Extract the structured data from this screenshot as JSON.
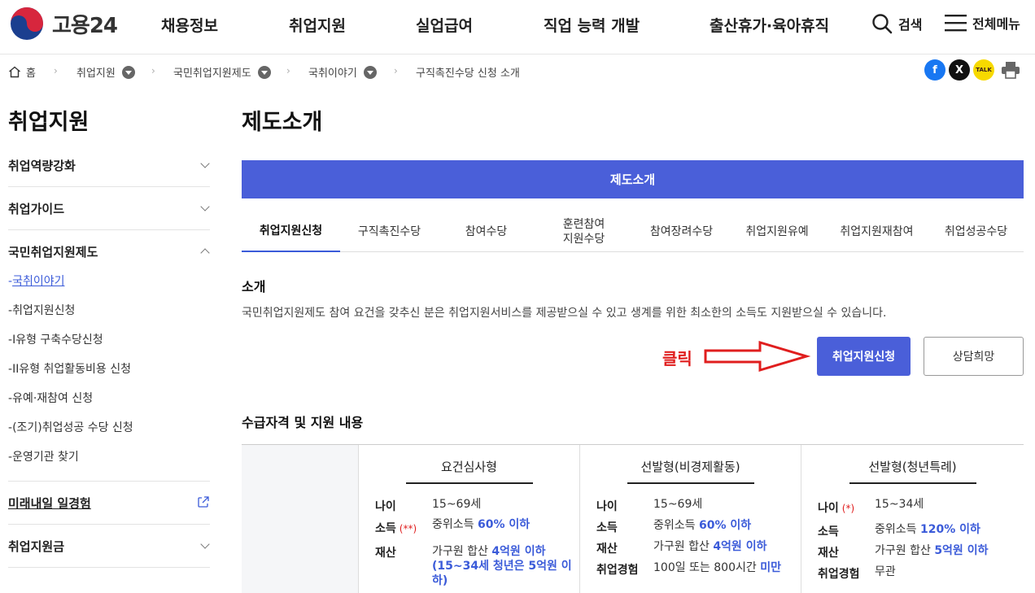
{
  "header": {
    "logo_text": "고용24",
    "nav": [
      "채용정보",
      "취업지원",
      "실업급여",
      "직업 능력 개발",
      "출산휴가·육아휴직"
    ],
    "search_label": "검색",
    "menu_label": "전체메뉴"
  },
  "breadcrumb": {
    "home": "홈",
    "items": [
      "취업지원",
      "국민취업지원제도",
      "국취이야기",
      "구직촉진수당 신청 소개"
    ]
  },
  "share": {
    "facebook": "f",
    "x": "X",
    "kakao": "TALK"
  },
  "sidebar": {
    "title": "취업지원",
    "items": [
      {
        "label": "취업역량강화"
      },
      {
        "label": "취업가이드"
      },
      {
        "label": "국민취업지원제도"
      }
    ],
    "sub_items": [
      {
        "prefix": "-",
        "label": "국취이야기"
      },
      {
        "prefix": "-",
        "label": "취업지원신청"
      },
      {
        "prefix": "-",
        "label": "I유형 구축수당신청"
      },
      {
        "prefix": "-",
        "label": "II유형 취업활동비용 신청"
      },
      {
        "prefix": "-",
        "label": "유예·재참여 신청"
      },
      {
        "prefix": "-",
        "label": "(조기)취업성공 수당 신청"
      },
      {
        "prefix": "-",
        "label": "운영기관 찾기"
      }
    ],
    "bottom_items": [
      {
        "label": "미래내일 일경험"
      },
      {
        "label": "취업지원금"
      }
    ]
  },
  "main": {
    "title": "제도소개",
    "bar_label": "제도소개",
    "tabs": [
      {
        "label": "취업지원신청"
      },
      {
        "label": "구직촉진수당"
      },
      {
        "label": "참여수당"
      },
      {
        "label": "훈련참여\n지원수당"
      },
      {
        "label": "참여장려수당"
      },
      {
        "label": "취업지원유예"
      },
      {
        "label": "취업지원재참여"
      },
      {
        "label": "취업성공수당"
      }
    ],
    "intro_title": "소개",
    "intro_text": "국민취업지원제도 참여 요건을 갖추신 분은 취업지원서비스를 제공받으실 수 있고 생계를 위한 최소한의 소득도 지원받으실 수 있습니다.",
    "annotation": "클릭",
    "apply_button": "취업지원신청",
    "consult_button": "상담희망",
    "eligibility_title": "수급자격 및 지원 내용"
  },
  "table": {
    "columns": [
      {
        "title": "요건심사형",
        "rows": [
          {
            "label": "나이",
            "mark": "",
            "value": "15~69세",
            "highlight": ""
          },
          {
            "label": "소득",
            "mark": "(**)",
            "value": "중위소득 ",
            "highlight": "60% 이하"
          },
          {
            "label": "재산",
            "mark": "",
            "value": "가구원 합산 ",
            "highlight": "4억원 이하"
          }
        ],
        "extra_line1": "(15~34세 청년은 5억원 이",
        "extra_line2": "하)"
      },
      {
        "title": "선발형(비경제활동)",
        "rows": [
          {
            "label": "나이",
            "mark": "",
            "value": "15~69세",
            "highlight": ""
          },
          {
            "label": "소득",
            "mark": "",
            "value": "중위소득 ",
            "highlight": "60% 이하"
          },
          {
            "label": "재산",
            "mark": "",
            "value": "가구원 합산 ",
            "highlight": "4억원 이하"
          },
          {
            "label": "취업경험",
            "mark": "",
            "value": "100일 또는 800시간 ",
            "highlight": "미만"
          }
        ]
      },
      {
        "title": "선발형(청년특례)",
        "rows": [
          {
            "label": "나이",
            "mark": "(*)",
            "value": "15~34세",
            "highlight": ""
          },
          {
            "label": "소득",
            "mark": "",
            "value": "중위소득 ",
            "highlight": "120% 이하"
          },
          {
            "label": "재산",
            "mark": "",
            "value": "가구원 합산 ",
            "highlight": "5억원 이하"
          },
          {
            "label": "취업경험",
            "mark": "",
            "value": "무관",
            "highlight": ""
          }
        ]
      }
    ]
  },
  "colors": {
    "accent": "#4a5fd9",
    "annotation": "#e01e1e",
    "link": "#3b5bd9"
  }
}
